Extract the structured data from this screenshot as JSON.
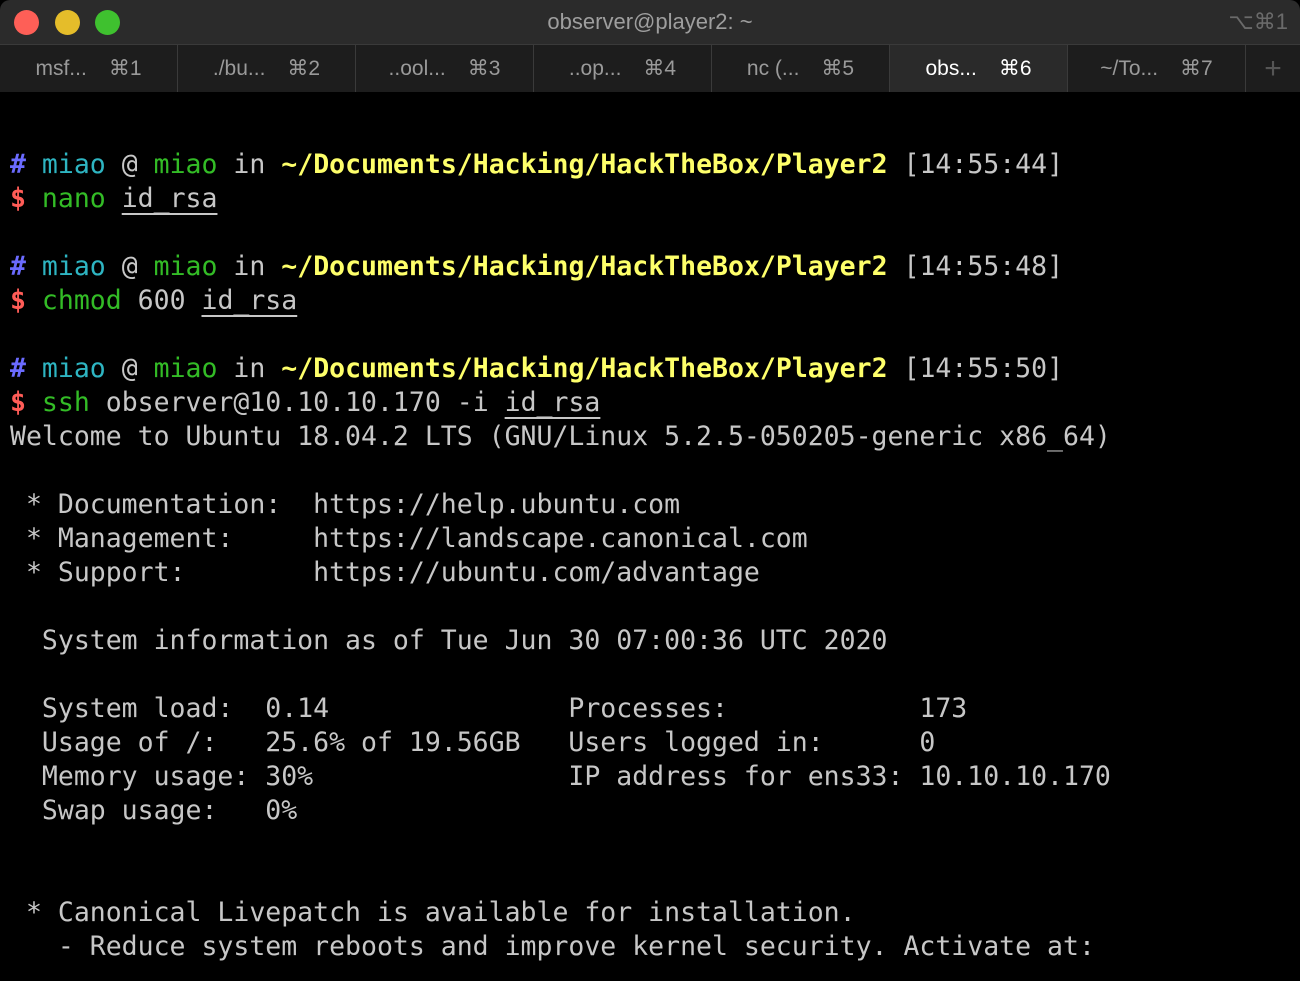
{
  "window": {
    "title": "observer@player2: ~",
    "shortcut": "⌥⌘1"
  },
  "tabs": [
    {
      "label": "msf...",
      "key": "⌘1",
      "active": false
    },
    {
      "label": "./bu...",
      "key": "⌘2",
      "active": false
    },
    {
      "label": "..ool...",
      "key": "⌘3",
      "active": false
    },
    {
      "label": "..op...",
      "key": "⌘4",
      "active": false
    },
    {
      "label": "nc (...",
      "key": "⌘5",
      "active": false
    },
    {
      "label": "obs...",
      "key": "⌘6",
      "active": true
    },
    {
      "label": "~/To...",
      "key": "⌘7",
      "active": false
    }
  ],
  "add_tab": "+",
  "terminal": [
    [],
    [
      {
        "c": "hash",
        "t": "# "
      },
      {
        "c": "user",
        "t": "miao"
      },
      {
        "c": "txt",
        "t": " @ "
      },
      {
        "c": "host",
        "t": "miao"
      },
      {
        "c": "txt",
        "t": " in "
      },
      {
        "c": "path",
        "t": "~/Documents/Hacking/HackTheBox/Player2"
      },
      {
        "c": "txt",
        "t": " [14:55:44]"
      }
    ],
    [
      {
        "c": "dollar",
        "t": "$ "
      },
      {
        "c": "cmd",
        "t": "nano"
      },
      {
        "c": "txt",
        "t": " "
      },
      {
        "c": "txt ul",
        "t": "id_rsa"
      }
    ],
    [],
    [
      {
        "c": "hash",
        "t": "# "
      },
      {
        "c": "user",
        "t": "miao"
      },
      {
        "c": "txt",
        "t": " @ "
      },
      {
        "c": "host",
        "t": "miao"
      },
      {
        "c": "txt",
        "t": " in "
      },
      {
        "c": "path",
        "t": "~/Documents/Hacking/HackTheBox/Player2"
      },
      {
        "c": "txt",
        "t": " [14:55:48]"
      }
    ],
    [
      {
        "c": "dollar",
        "t": "$ "
      },
      {
        "c": "cmd",
        "t": "chmod"
      },
      {
        "c": "txt",
        "t": " 600 "
      },
      {
        "c": "txt ul",
        "t": "id_rsa"
      }
    ],
    [],
    [
      {
        "c": "hash",
        "t": "# "
      },
      {
        "c": "user",
        "t": "miao"
      },
      {
        "c": "txt",
        "t": " @ "
      },
      {
        "c": "host",
        "t": "miao"
      },
      {
        "c": "txt",
        "t": " in "
      },
      {
        "c": "path",
        "t": "~/Documents/Hacking/HackTheBox/Player2"
      },
      {
        "c": "txt",
        "t": " [14:55:50]"
      }
    ],
    [
      {
        "c": "dollar",
        "t": "$ "
      },
      {
        "c": "cmd",
        "t": "ssh"
      },
      {
        "c": "txt",
        "t": " observer@10.10.10.170 -i "
      },
      {
        "c": "txt ul",
        "t": "id_rsa"
      }
    ],
    [
      {
        "c": "txt",
        "t": "Welcome to Ubuntu 18.04.2 LTS (GNU/Linux 5.2.5-050205-generic x86_64)"
      }
    ],
    [],
    [
      {
        "c": "txt",
        "t": " * Documentation:  https://help.ubuntu.com"
      }
    ],
    [
      {
        "c": "txt",
        "t": " * Management:     https://landscape.canonical.com"
      }
    ],
    [
      {
        "c": "txt",
        "t": " * Support:        https://ubuntu.com/advantage"
      }
    ],
    [],
    [
      {
        "c": "txt",
        "t": "  System information as of Tue Jun 30 07:00:36 UTC 2020"
      }
    ],
    [],
    [
      {
        "c": "txt",
        "t": "  System load:  0.14               Processes:            173"
      }
    ],
    [
      {
        "c": "txt",
        "t": "  Usage of /:   25.6% of 19.56GB   Users logged in:      0"
      }
    ],
    [
      {
        "c": "txt",
        "t": "  Memory usage: 30%                IP address for ens33: 10.10.10.170"
      }
    ],
    [
      {
        "c": "txt",
        "t": "  Swap usage:   0%"
      }
    ],
    [],
    [],
    [
      {
        "c": "txt",
        "t": " * Canonical Livepatch is available for installation."
      }
    ],
    [
      {
        "c": "txt",
        "t": "   - Reduce system reboots and improve kernel security. Activate at:"
      }
    ]
  ]
}
